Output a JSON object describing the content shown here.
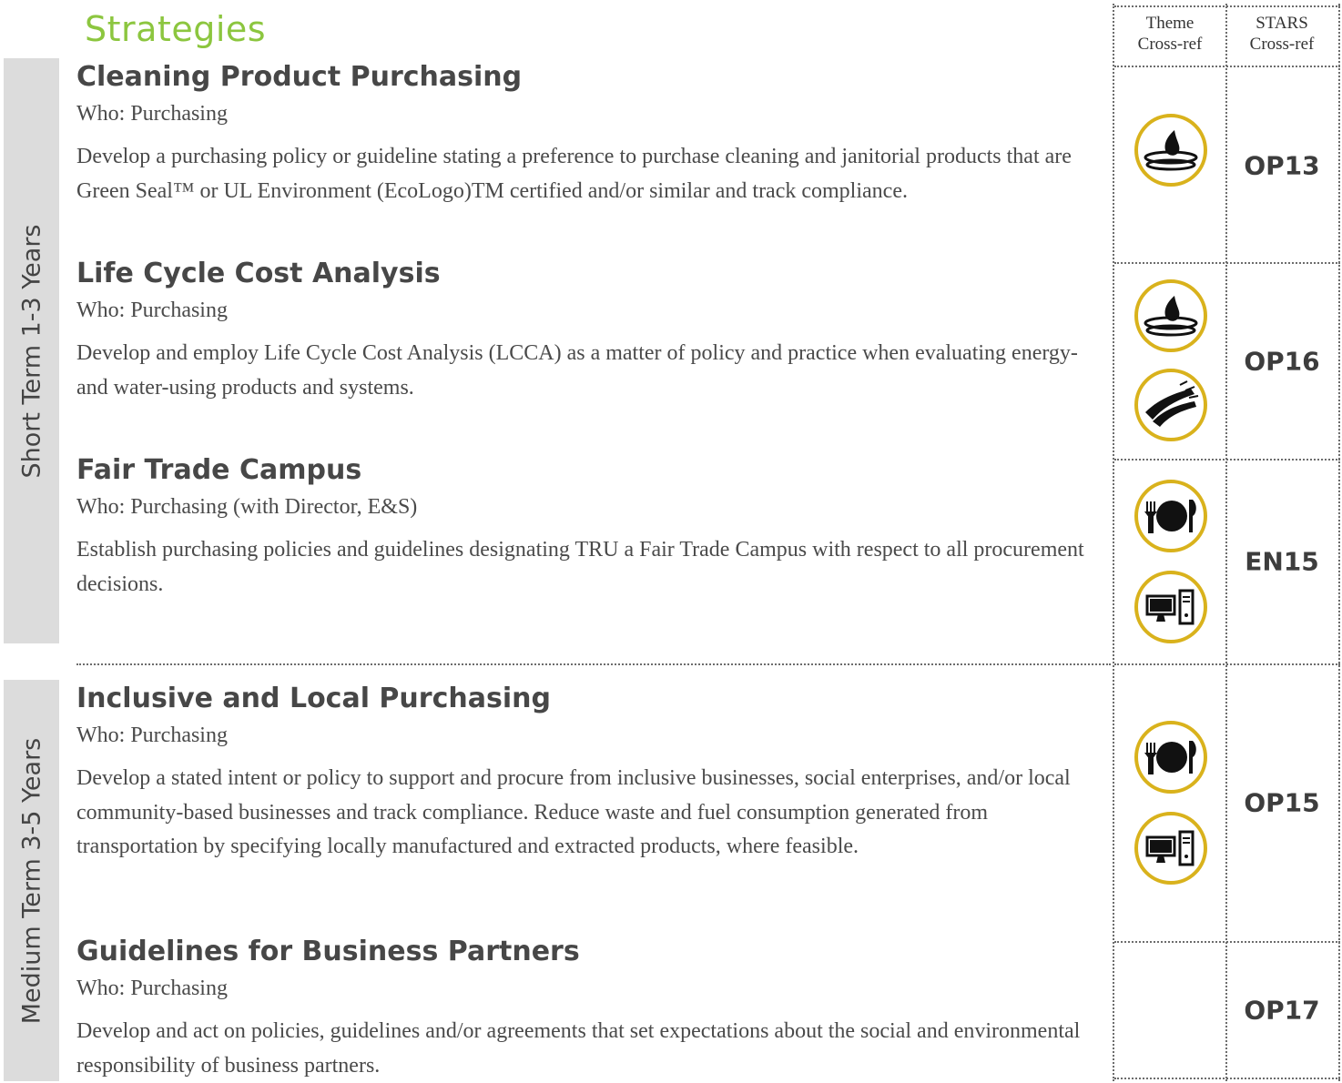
{
  "page": {
    "heading": "Strategies",
    "columns": {
      "theme": "Theme\nCross-ref",
      "stars": "STARS\nCross-ref"
    }
  },
  "sections": {
    "short_term": "Short Term 1-3 Years",
    "medium_term": "Medium Term 3-5 Years"
  },
  "strategies": [
    {
      "title": "Cleaning Product Purchasing",
      "who": "Who: Purchasing",
      "description": "Develop a purchasing policy or guideline stating a preference to purchase cleaning and janitorial products that are Green Seal™ or UL Environment (EcoLogo)TM certified and/or similar and track compliance.",
      "stars": "OP13",
      "icons": [
        "water-drop-icon"
      ]
    },
    {
      "title": "Life Cycle Cost Analysis",
      "who": "Who: Purchasing",
      "description": "Develop and employ Life Cycle Cost Analysis (LCCA) as a matter of policy and practice when evaluating energy- and water-using products and systems.",
      "stars": "OP16",
      "icons": [
        "water-drop-icon",
        "energy-wind-icon"
      ]
    },
    {
      "title": "Fair Trade Campus",
      "who": "Who: Purchasing (with Director, E&S)",
      "description": "Establish purchasing policies and guidelines designating TRU a Fair Trade Campus with respect to all procurement decisions.",
      "stars": "EN15",
      "icons": [
        "food-plate-icon",
        "computer-icon"
      ]
    },
    {
      "title": "Inclusive and Local Purchasing",
      "who": "Who: Purchasing",
      "description": "Develop a stated intent or policy to support and procure from inclusive businesses, social enterprises, and/or local community-based businesses and track compliance. Reduce waste and fuel consumption generated from transportation by specifying locally manufactured and extracted products, where feasible.",
      "stars": "OP15",
      "icons": [
        "food-plate-icon",
        "computer-icon"
      ]
    },
    {
      "title": "Guidelines for Business Partners",
      "who": "Who: Purchasing",
      "description": "Develop and act on policies, guidelines and/or agreements that set expectations about the social and environmental responsibility of business partners.",
      "stars": "OP17",
      "icons": []
    }
  ],
  "colors": {
    "heading_accent": "#8cc63f",
    "icon_ring": "#d9b21c",
    "side_band": "#dcdcdc"
  }
}
